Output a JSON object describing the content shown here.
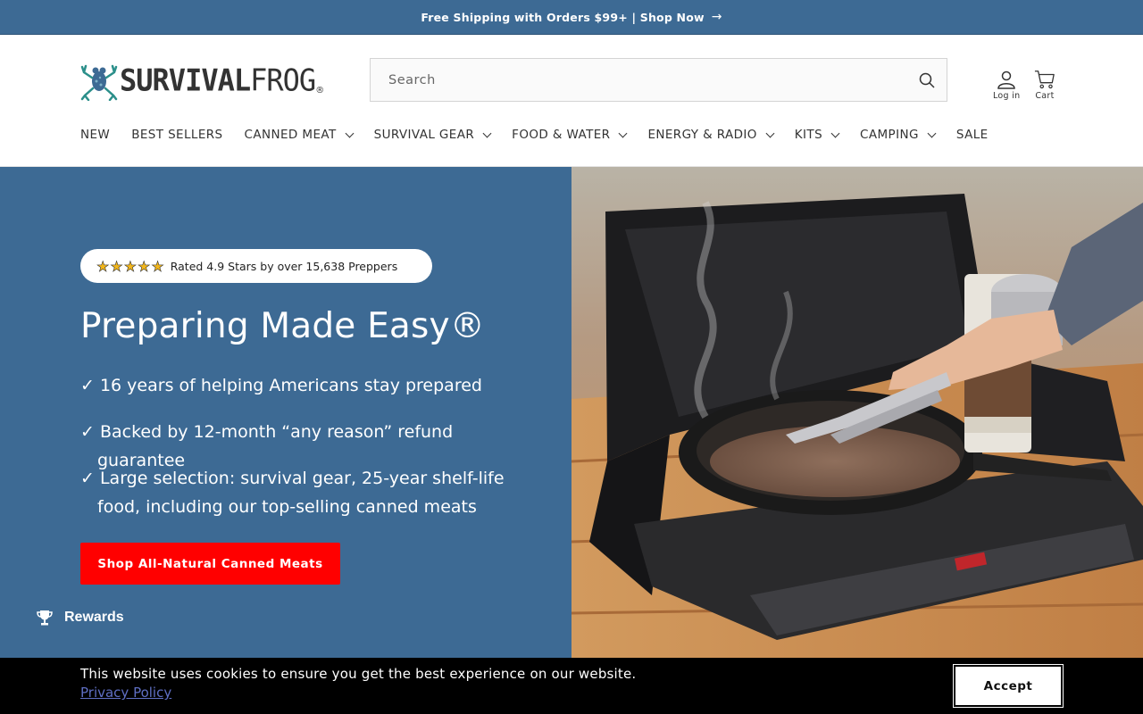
{
  "announcement": {
    "text": "Free Shipping with Orders $99+ | Shop Now",
    "icon": "arrow-right-icon"
  },
  "header": {
    "logo": {
      "bold": "SURVIVAL",
      "light": "FROG",
      "mark": "®"
    },
    "search": {
      "placeholder": "Search",
      "icon": "search-icon"
    },
    "login_label": "Log in",
    "cart_label": "Cart"
  },
  "nav": {
    "items": [
      {
        "label": "NEW",
        "dropdown": false
      },
      {
        "label": "BEST SELLERS",
        "dropdown": false
      },
      {
        "label": "CANNED MEAT",
        "dropdown": true
      },
      {
        "label": "SURVIVAL GEAR",
        "dropdown": true
      },
      {
        "label": "FOOD & WATER",
        "dropdown": true
      },
      {
        "label": "ENERGY & RADIO",
        "dropdown": true
      },
      {
        "label": "KITS",
        "dropdown": true
      },
      {
        "label": "CAMPING",
        "dropdown": true
      },
      {
        "label": "SALE",
        "dropdown": false
      }
    ]
  },
  "hero": {
    "rating_stars": 5,
    "rating_text": "Rated 4.9 Stars by over 15,638 Preppers",
    "title": "Preparing Made Easy®",
    "bullets": [
      "✓ 16 years of helping Americans stay prepared",
      "✓ Backed by 12-month “any reason” refund guarantee",
      "✓ Large selection: survival gear, 25-year shelf-life food, including our top-selling canned meats"
    ],
    "cta_label": "Shop All-Natural Canned Meats"
  },
  "rewards": {
    "label": "Rewards",
    "icon": "trophy-icon"
  },
  "cookie": {
    "message": "This website uses cookies to ensure you get the best experience on our website.",
    "link": "Privacy Policy",
    "accept_label": "Accept"
  },
  "colors": {
    "brand_blue": "#3d6a94",
    "cta_red": "#ff0000",
    "star_gold": "#f2b61b"
  }
}
